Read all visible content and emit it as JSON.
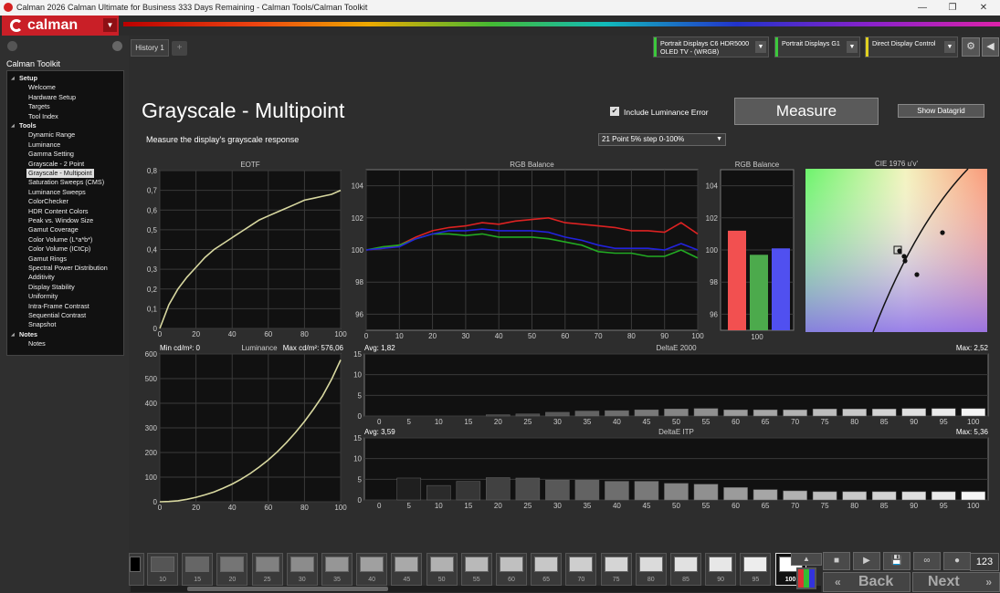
{
  "window": {
    "title": "Calman 2026 Calman Ultimate for Business 333 Days Remaining  - Calman Tools/Calman Toolkit",
    "minimize": "—",
    "maximize": "❐",
    "close": "✕"
  },
  "logo": {
    "text": "calman",
    "dropdown": "▼"
  },
  "sidebar": {
    "title": "Calman Toolkit",
    "items": [
      {
        "label": "Setup",
        "header": true
      },
      {
        "label": "Welcome"
      },
      {
        "label": "Hardware Setup"
      },
      {
        "label": "Targets"
      },
      {
        "label": "Tool Index"
      },
      {
        "label": "Tools",
        "header": true
      },
      {
        "label": "Dynamic Range"
      },
      {
        "label": "Luminance"
      },
      {
        "label": "Gamma Setting"
      },
      {
        "label": "Grayscale - 2 Point"
      },
      {
        "label": "Grayscale - Multipoint",
        "selected": true
      },
      {
        "label": "Saturation Sweeps (CMS)"
      },
      {
        "label": "Luminance Sweeps"
      },
      {
        "label": "ColorChecker"
      },
      {
        "label": "HDR Content Colors"
      },
      {
        "label": "Peak vs. Window Size"
      },
      {
        "label": "Gamut Coverage"
      },
      {
        "label": "Color Volume (L*a*b*)"
      },
      {
        "label": "Color Volume (ICtCp)"
      },
      {
        "label": "Gamut Rings"
      },
      {
        "label": "Spectral Power Distribution"
      },
      {
        "label": "Additivity"
      },
      {
        "label": "Display Stability"
      },
      {
        "label": "Uniformity"
      },
      {
        "label": "Intra-Frame Contrast"
      },
      {
        "label": "Sequential Contrast"
      },
      {
        "label": "Snapshot"
      },
      {
        "label": "Notes",
        "header": true
      },
      {
        "label": "Notes"
      }
    ]
  },
  "tabs": {
    "history": "History 1",
    "add": "+"
  },
  "devices": [
    {
      "line1": "Portrait Displays C6 HDR5000",
      "line2": "OLED TV - (WRGB)",
      "color": "#3cc83c"
    },
    {
      "line1": "Portrait Displays G1",
      "line2": "",
      "color": "#3cc83c"
    },
    {
      "line1": "Direct Display Control",
      "line2": "",
      "color": "#e0d020"
    }
  ],
  "toolbar": {
    "settings_icon": "⚙",
    "collapse_icon": "◀"
  },
  "page": {
    "title": "Grayscale - Multipoint",
    "subtitle": "Measure the display's grayscale response",
    "include_luminance_error": "Include Luminance Error",
    "include_luminance_checked": "✔",
    "measure": "Measure",
    "show_datagrid": "Show Datagrid",
    "point_select": "21 Point 5% step 0-100%"
  },
  "colors": {
    "red": "#dd2222",
    "green": "#22aa22",
    "blue": "#2222dd",
    "curve": "#d8d890"
  },
  "chart_data": [
    {
      "type": "line",
      "title": "EOTF",
      "x": [
        0,
        5,
        10,
        15,
        20,
        25,
        30,
        35,
        40,
        45,
        50,
        55,
        60,
        65,
        70,
        75,
        80,
        85,
        90,
        95,
        100
      ],
      "y": [
        0,
        0.12,
        0.2,
        0.26,
        0.31,
        0.36,
        0.4,
        0.43,
        0.46,
        0.49,
        0.52,
        0.55,
        0.57,
        0.59,
        0.61,
        0.63,
        0.65,
        0.66,
        0.67,
        0.68,
        0.7
      ],
      "xlim": [
        0,
        100
      ],
      "ylim": [
        0,
        0.8
      ],
      "xticks": [
        "0",
        "20",
        "40",
        "60",
        "80",
        "100"
      ],
      "yticks": [
        "0",
        "0,1",
        "0,2",
        "0,3",
        "0,4",
        "0,5",
        "0,6",
        "0,7",
        "0,8"
      ]
    },
    {
      "type": "line",
      "title": "RGB Balance",
      "x": [
        0,
        5,
        10,
        15,
        20,
        25,
        30,
        35,
        40,
        45,
        50,
        55,
        60,
        65,
        70,
        75,
        80,
        85,
        90,
        95,
        100
      ],
      "series": [
        {
          "name": "Red",
          "values": [
            100,
            100.1,
            100.3,
            100.8,
            101.2,
            101.4,
            101.5,
            101.7,
            101.6,
            101.8,
            101.9,
            102.0,
            101.7,
            101.6,
            101.5,
            101.4,
            101.2,
            101.2,
            101.1,
            101.7,
            101.0
          ]
        },
        {
          "name": "Green",
          "values": [
            100,
            100.2,
            100.3,
            100.7,
            101,
            101.0,
            100.9,
            101.0,
            100.8,
            100.8,
            100.8,
            100.7,
            100.5,
            100.3,
            99.9,
            99.8,
            99.8,
            99.6,
            99.6,
            100.0,
            99.5
          ]
        },
        {
          "name": "Blue",
          "values": [
            100,
            100.1,
            100.2,
            100.7,
            101.0,
            101.2,
            101.2,
            101.3,
            101.2,
            101.2,
            101.2,
            101.1,
            100.8,
            100.6,
            100.3,
            100.1,
            100.1,
            100.1,
            100.0,
            100.4,
            100.0
          ]
        }
      ],
      "xlim": [
        0,
        100
      ],
      "ylim": [
        95,
        105
      ],
      "xticks": [
        "0",
        "10",
        "20",
        "30",
        "40",
        "50",
        "60",
        "70",
        "80",
        "90",
        "100"
      ],
      "yticks": [
        "96",
        "98",
        "100",
        "102",
        "104"
      ]
    },
    {
      "type": "bar",
      "title": "RGB Balance",
      "categories": [
        "100"
      ],
      "series": [
        {
          "name": "Red",
          "values": [
            101.2
          ]
        },
        {
          "name": "Green",
          "values": [
            99.7
          ]
        },
        {
          "name": "Blue",
          "values": [
            100.1
          ]
        }
      ],
      "ylim": [
        95,
        105
      ],
      "yticks": [
        "96",
        "98",
        "100",
        "102",
        "104"
      ]
    },
    {
      "type": "scatter",
      "title": "CIE 1976 u'v'"
    },
    {
      "type": "line",
      "title": "Luminance",
      "min_label": "Min cd/m²: 0",
      "max_label": "Max cd/m²: 576,06",
      "x": [
        0,
        5,
        10,
        15,
        20,
        25,
        30,
        35,
        40,
        45,
        50,
        55,
        60,
        65,
        70,
        75,
        80,
        85,
        90,
        95,
        100
      ],
      "y": [
        0,
        1,
        4,
        10,
        18,
        28,
        40,
        55,
        72,
        92,
        115,
        141,
        170,
        203,
        240,
        281,
        326,
        376,
        430,
        497,
        576
      ],
      "xlim": [
        0,
        100
      ],
      "ylim": [
        0,
        600
      ],
      "xticks": [
        "0",
        "20",
        "40",
        "60",
        "80",
        "100"
      ],
      "yticks": [
        "0",
        "100",
        "200",
        "300",
        "400",
        "500",
        "600"
      ]
    },
    {
      "type": "bar",
      "title": "DeltaE 2000",
      "avg_label": "Avg: 1,82",
      "max_label": "Max: 2,52",
      "categories": [
        "0",
        "5",
        "10",
        "15",
        "20",
        "25",
        "30",
        "35",
        "40",
        "45",
        "50",
        "55",
        "60",
        "65",
        "70",
        "75",
        "80",
        "85",
        "90",
        "95",
        "100"
      ],
      "values": [
        0,
        0,
        0,
        0,
        0.3,
        0.5,
        0.9,
        1.2,
        1.3,
        1.5,
        1.7,
        1.8,
        1.5,
        1.5,
        1.5,
        1.7,
        1.7,
        1.7,
        1.8,
        1.8,
        1.8
      ],
      "ylim": [
        0,
        15
      ],
      "yticks": [
        "0",
        "5",
        "10",
        "15"
      ]
    },
    {
      "type": "bar",
      "title": "DeltaE ITP",
      "avg_label": "Avg: 3,59",
      "max_label": "Max: 5,36",
      "categories": [
        "0",
        "5",
        "10",
        "15",
        "20",
        "25",
        "30",
        "35",
        "40",
        "45",
        "50",
        "55",
        "60",
        "65",
        "70",
        "75",
        "80",
        "85",
        "90",
        "95",
        "100"
      ],
      "values": [
        0,
        5.3,
        3.5,
        4.5,
        5.4,
        5.3,
        4.8,
        4.8,
        4.5,
        4.5,
        4.0,
        3.8,
        3.0,
        2.5,
        2.2,
        2.0,
        2.0,
        2.0,
        2.0,
        2.0,
        2.0
      ],
      "ylim": [
        0,
        15
      ],
      "yticks": [
        "0",
        "5",
        "10",
        "15"
      ]
    }
  ],
  "swatches": [
    "10",
    "15",
    "20",
    "25",
    "30",
    "35",
    "40",
    "45",
    "50",
    "55",
    "60",
    "65",
    "70",
    "75",
    "80",
    "85",
    "90",
    "95",
    "100"
  ],
  "selected_swatch": "100",
  "controls": {
    "stop": "■",
    "play": "▶",
    "save": "💾",
    "loop": "∞",
    "counter": "123",
    "up": "▲",
    "back": "Back",
    "next": "Next",
    "back_arrow": "«",
    "next_arrow": "»"
  }
}
